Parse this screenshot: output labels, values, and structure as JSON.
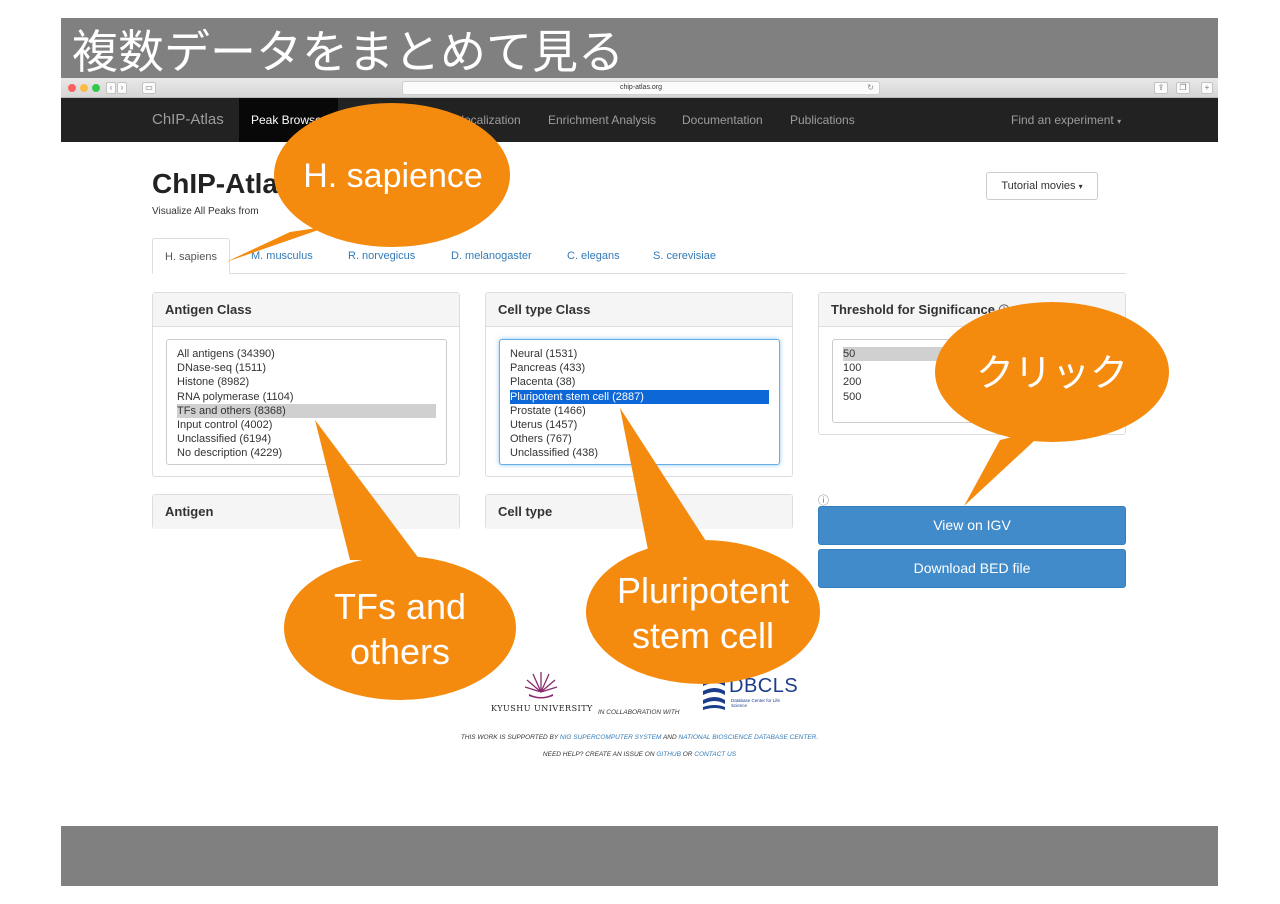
{
  "slide": {
    "title": "複数データをまとめて見る"
  },
  "browser": {
    "url": "chip-atlas.org"
  },
  "navbar": {
    "brand": "ChIP-Atlas",
    "items": [
      {
        "label": "Peak Browser"
      },
      {
        "label": "Colocalization"
      },
      {
        "label": "Enrichment Analysis"
      },
      {
        "label": "Documentation"
      },
      {
        "label": "Publications"
      },
      {
        "label": "Find an experiment"
      }
    ]
  },
  "page": {
    "heading": "ChIP-Atlas",
    "subtitle": "Visualize All Peaks from",
    "tutorial_label": "Tutorial movies"
  },
  "tabs": [
    {
      "label": "H. sapiens"
    },
    {
      "label": "M. musculus"
    },
    {
      "label": "R. norvegicus"
    },
    {
      "label": "D. melanogaster"
    },
    {
      "label": "C. elegans"
    },
    {
      "label": "S. cerevisiae"
    }
  ],
  "antigen_class": {
    "title": "Antigen Class",
    "options": [
      "All antigens (34390)",
      "DNase-seq (1511)",
      "Histone (8982)",
      "RNA polymerase (1104)",
      "TFs and others (8368)",
      "Input control (4002)",
      "Unclassified (6194)",
      "No description (4229)"
    ],
    "selected": "TFs and others (8368)"
  },
  "cell_type_class": {
    "title": "Cell type Class",
    "options": [
      "Neural (1531)",
      "Pancreas (433)",
      "Placenta (38)",
      "Pluripotent stem cell (2887)",
      "Prostate (1466)",
      "Uterus (1457)",
      "Others (767)",
      "Unclassified (438)"
    ],
    "selected": "Pluripotent stem cell (2887)"
  },
  "threshold": {
    "title": "Threshold for Significance",
    "options": [
      "50",
      "100",
      "200",
      "500"
    ],
    "selected": "50"
  },
  "antigen": {
    "title": "Antigen"
  },
  "cell_type": {
    "title": "Cell type"
  },
  "actions": {
    "view_igv": "View on IGV",
    "download_bed": "Download BED file"
  },
  "footer": {
    "kyushu": "KYUSHU UNIVERSITY",
    "collab": "IN COLLABORATION WITH",
    "dbcls": "DBCLS",
    "dbcls_sub": "Database Center for Life Science",
    "supported_prefix": "THIS WORK IS SUPPORTED BY",
    "nig": "NIG SUPERCOMPUTER SYSTEM",
    "and": "AND",
    "nbdc": "NATIONAL BIOSCIENCE DATABASE CENTER.",
    "help_prefix": "NEED HELP? CREATE AN ISSUE ON",
    "github": "GITHUB",
    "or": "OR",
    "contact": "CONTACT US"
  },
  "callouts": {
    "species": "H. sapience",
    "click": "クリック",
    "tfs_line1": "TFs and",
    "tfs_line2": "others",
    "stem_line1": "Pluripotent",
    "stem_line2": "stem cell"
  },
  "colors": {
    "callout_orange": "#f48a0e",
    "navbar": "#222222",
    "primary_button": "#428bca",
    "link": "#337ab7",
    "selected_option": "#0e67d6"
  }
}
